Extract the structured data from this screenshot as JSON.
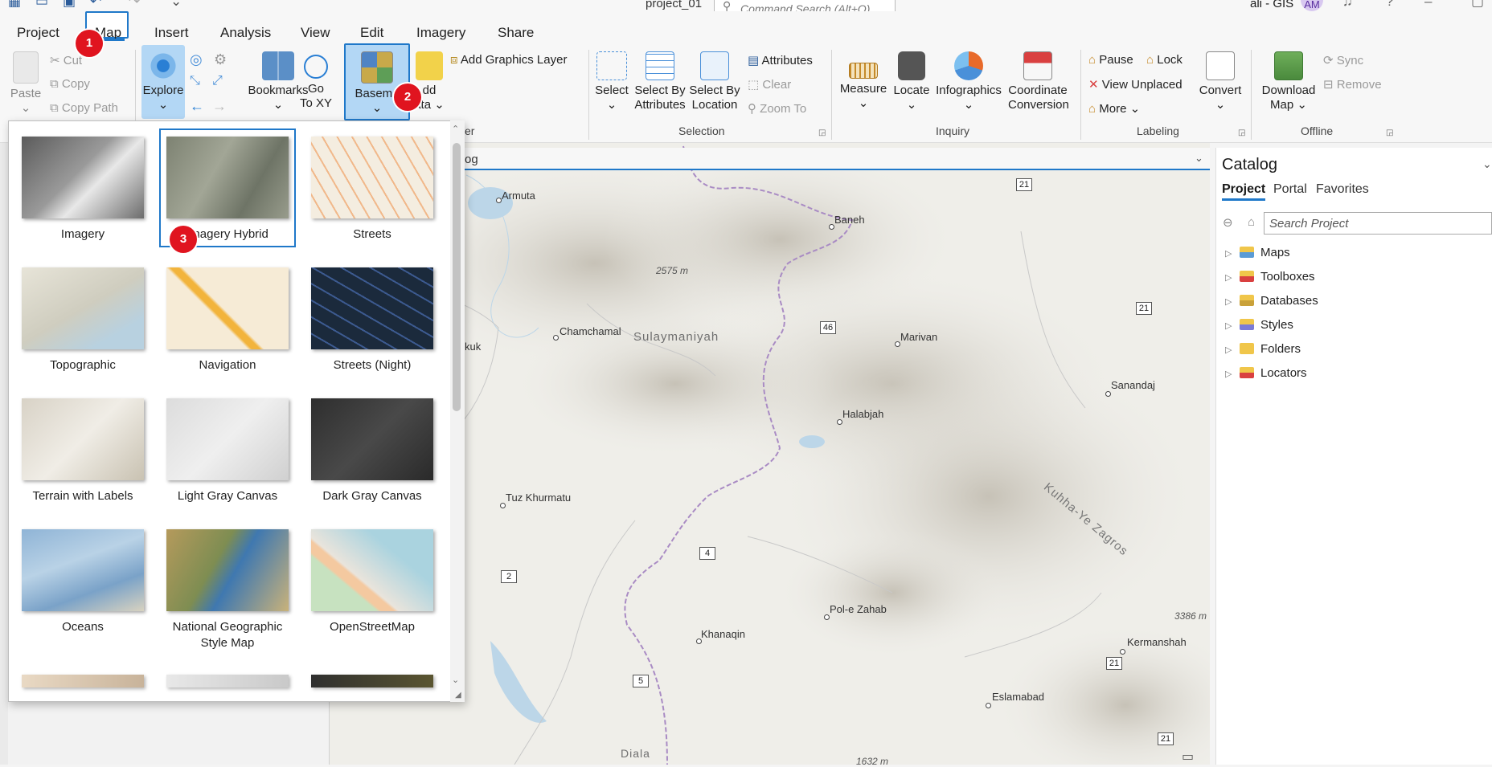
{
  "title_bar": {
    "document_title": "project_01",
    "command_search_placeholder": "Command Search (Alt+Q)",
    "user_name": "ali - GIS",
    "user_initials": "AM"
  },
  "ribbon_tabs": [
    "Project",
    "Map",
    "Insert",
    "Analysis",
    "View",
    "Edit",
    "Imagery",
    "Share"
  ],
  "ribbon": {
    "clipboard": {
      "paste": "Paste",
      "cut": "Cut",
      "copy": "Copy",
      "copy_path": "Copy Path"
    },
    "navigate": {
      "explore": "Explore",
      "bookmarks": "Bookmarks",
      "go_to_xy_line1": "Go",
      "go_to_xy_line2": "To XY"
    },
    "layer": {
      "basemap": "Basema",
      "add_data_line1": "dd",
      "add_data_line2": "ata",
      "add_graphics_layer": "Add Graphics Layer",
      "group_partial": "er"
    },
    "selection": {
      "select": "Select",
      "select_by_attributes_line1": "Select By",
      "select_by_attributes_line2": "Attributes",
      "select_by_location_line1": "Select By",
      "select_by_location_line2": "Location",
      "attributes": "Attributes",
      "clear": "Clear",
      "zoom_to": "Zoom To",
      "group": "Selection"
    },
    "inquiry": {
      "measure": "Measure",
      "locate": "Locate",
      "infographics": "Infographics",
      "coordinate_line1": "Coordinate",
      "coordinate_line2": "Conversion",
      "group": "Inquiry"
    },
    "labeling": {
      "pause": "Pause",
      "lock": "Lock",
      "view_unplaced": "View Unplaced",
      "more": "More",
      "convert": "Convert",
      "group": "Labeling"
    },
    "offline": {
      "download_line1": "Download",
      "download_line2": "Map",
      "sync": "Sync",
      "remove": "Remove",
      "group": "Offline"
    }
  },
  "step_badges": [
    "1",
    "2",
    "3"
  ],
  "basemap_gallery": [
    {
      "label": "Imagery",
      "thumb": "imagery"
    },
    {
      "label": "Imagery Hybrid",
      "thumb": "imagery-hybrid",
      "selected": true
    },
    {
      "label": "Streets",
      "thumb": "streets"
    },
    {
      "label": "Topographic",
      "thumb": "topographic"
    },
    {
      "label": "Navigation",
      "thumb": "navigation"
    },
    {
      "label": "Streets (Night)",
      "thumb": "streets-night"
    },
    {
      "label": "Terrain with Labels",
      "thumb": "terrain"
    },
    {
      "label": "Light Gray Canvas",
      "thumb": "light-gray"
    },
    {
      "label": "Dark Gray Canvas",
      "thumb": "dark-gray"
    },
    {
      "label": "Oceans",
      "thumb": "oceans"
    },
    {
      "label": "National Geographic Style Map",
      "thumb": "natgeo"
    },
    {
      "label": "OpenStreetMap",
      "thumb": "osm"
    }
  ],
  "map": {
    "tab_label": "og",
    "places": [
      "Armuta",
      "Baneh",
      "Chamchamal",
      "Sulaymaniyah",
      "Marivan",
      "Sanandaj",
      "kuk",
      "Halabjah",
      "Tuz Khurmatu",
      "Kuhha-Ye Zagros",
      "Pol-e Zahab",
      "Khanaqin",
      "Kermanshah",
      "Eslamabad",
      "Diala"
    ],
    "elevations": [
      "2575 m",
      "3386 m",
      "1632 m"
    ],
    "road_shields": [
      "21",
      "21",
      "46",
      "4",
      "2",
      "5",
      "21",
      "21"
    ]
  },
  "catalog": {
    "title": "Catalog",
    "tabs": [
      "Project",
      "Portal",
      "Favorites"
    ],
    "search_placeholder": "Search Project",
    "items": [
      "Maps",
      "Toolboxes",
      "Databases",
      "Styles",
      "Folders",
      "Locators"
    ]
  },
  "colors": {
    "accent": "#1f78c9",
    "selected_fill": "#b3d7f5",
    "badge": "#e0141f"
  }
}
